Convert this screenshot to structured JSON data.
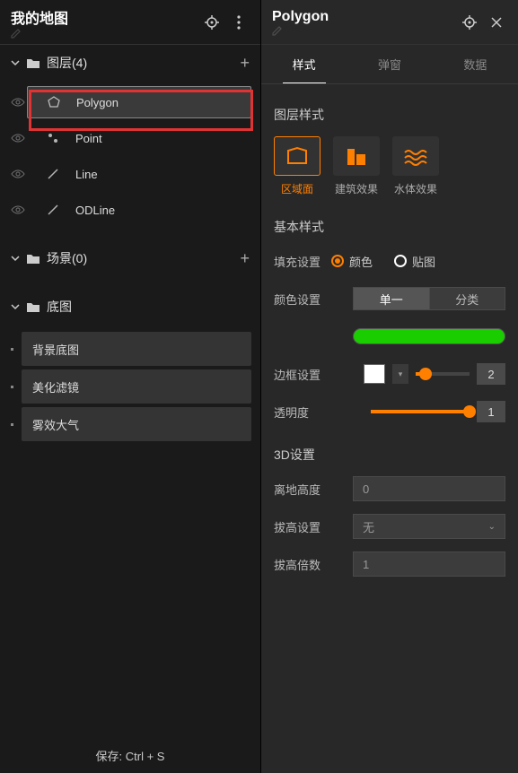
{
  "leftPanel": {
    "title": "我的地图",
    "sections": {
      "layers": {
        "label": "图层(4)"
      },
      "scenes": {
        "label": "场景(0)"
      },
      "basemap": {
        "label": "底图"
      }
    },
    "layers": [
      {
        "name": "Polygon"
      },
      {
        "name": "Point"
      },
      {
        "name": "Line"
      },
      {
        "name": "ODLine"
      }
    ],
    "basemapItems": [
      {
        "name": "背景底图"
      },
      {
        "name": "美化滤镜"
      },
      {
        "name": "雾效大气"
      }
    ],
    "saveHint": "保存:  Ctrl + S"
  },
  "rightPanel": {
    "title": "Polygon",
    "tabs": {
      "style": "样式",
      "popup": "弹窗",
      "data": "数据"
    },
    "sections": {
      "layerStyle": "图层样式",
      "basicStyle": "基本样式",
      "threeD": "3D设置"
    },
    "styleCards": {
      "area": "区域面",
      "building": "建筑效果",
      "water": "水体效果"
    },
    "rows": {
      "fill": "填充设置",
      "fillOpts": {
        "color": "颜色",
        "texture": "贴图"
      },
      "colorMode": "颜色设置",
      "colorOpts": {
        "single": "单一",
        "classify": "分类"
      },
      "border": "边框设置",
      "borderWidth": "2",
      "opacity": "透明度",
      "opacityVal": "1",
      "groundHeight": "离地高度",
      "groundHeightVal": "0",
      "extrude": "拔高设置",
      "extrudeVal": "无",
      "extrudeMult": "拔高倍数",
      "extrudeMultVal": "1"
    }
  }
}
